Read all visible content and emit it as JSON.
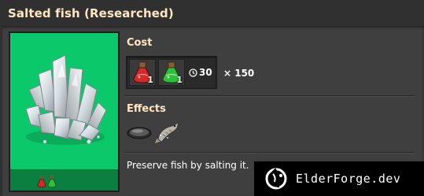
{
  "title": "Salted fish (Researched)",
  "cost": {
    "heading": "Cost",
    "packs": [
      {
        "icon": "red-science-pack-icon",
        "count": "1",
        "color": "#d12b2b"
      },
      {
        "icon": "green-science-pack-icon",
        "count": "1",
        "color": "#2fbf3a"
      }
    ],
    "time": "30",
    "multiplier": "× 150"
  },
  "effects": {
    "heading": "Effects",
    "items": [
      "dish-icon",
      "fish-icon"
    ]
  },
  "description": "Preserve fish by salting it.",
  "card": {
    "background": "#0bc96a",
    "bar": "#0a7f3f"
  },
  "watermark": "ElderForge.dev"
}
